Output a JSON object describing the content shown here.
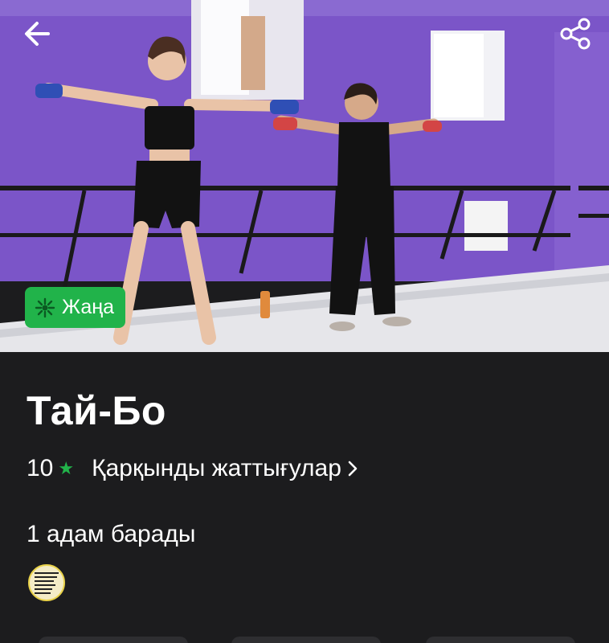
{
  "header": {
    "back_icon": "arrow-left-icon",
    "share_icon": "share-icon"
  },
  "badge": {
    "label": "Жаңа",
    "icon": "sparkle-icon",
    "color": "#21b34a"
  },
  "event": {
    "title": "Тай-Бо",
    "rating": "10",
    "rating_icon": "star-icon",
    "category": "Қарқынды жаттығулар",
    "attendees": "1 адам барады"
  },
  "colors": {
    "accent": "#21b34a",
    "background": "#1c1c1e",
    "wall": "#7b55c8"
  }
}
